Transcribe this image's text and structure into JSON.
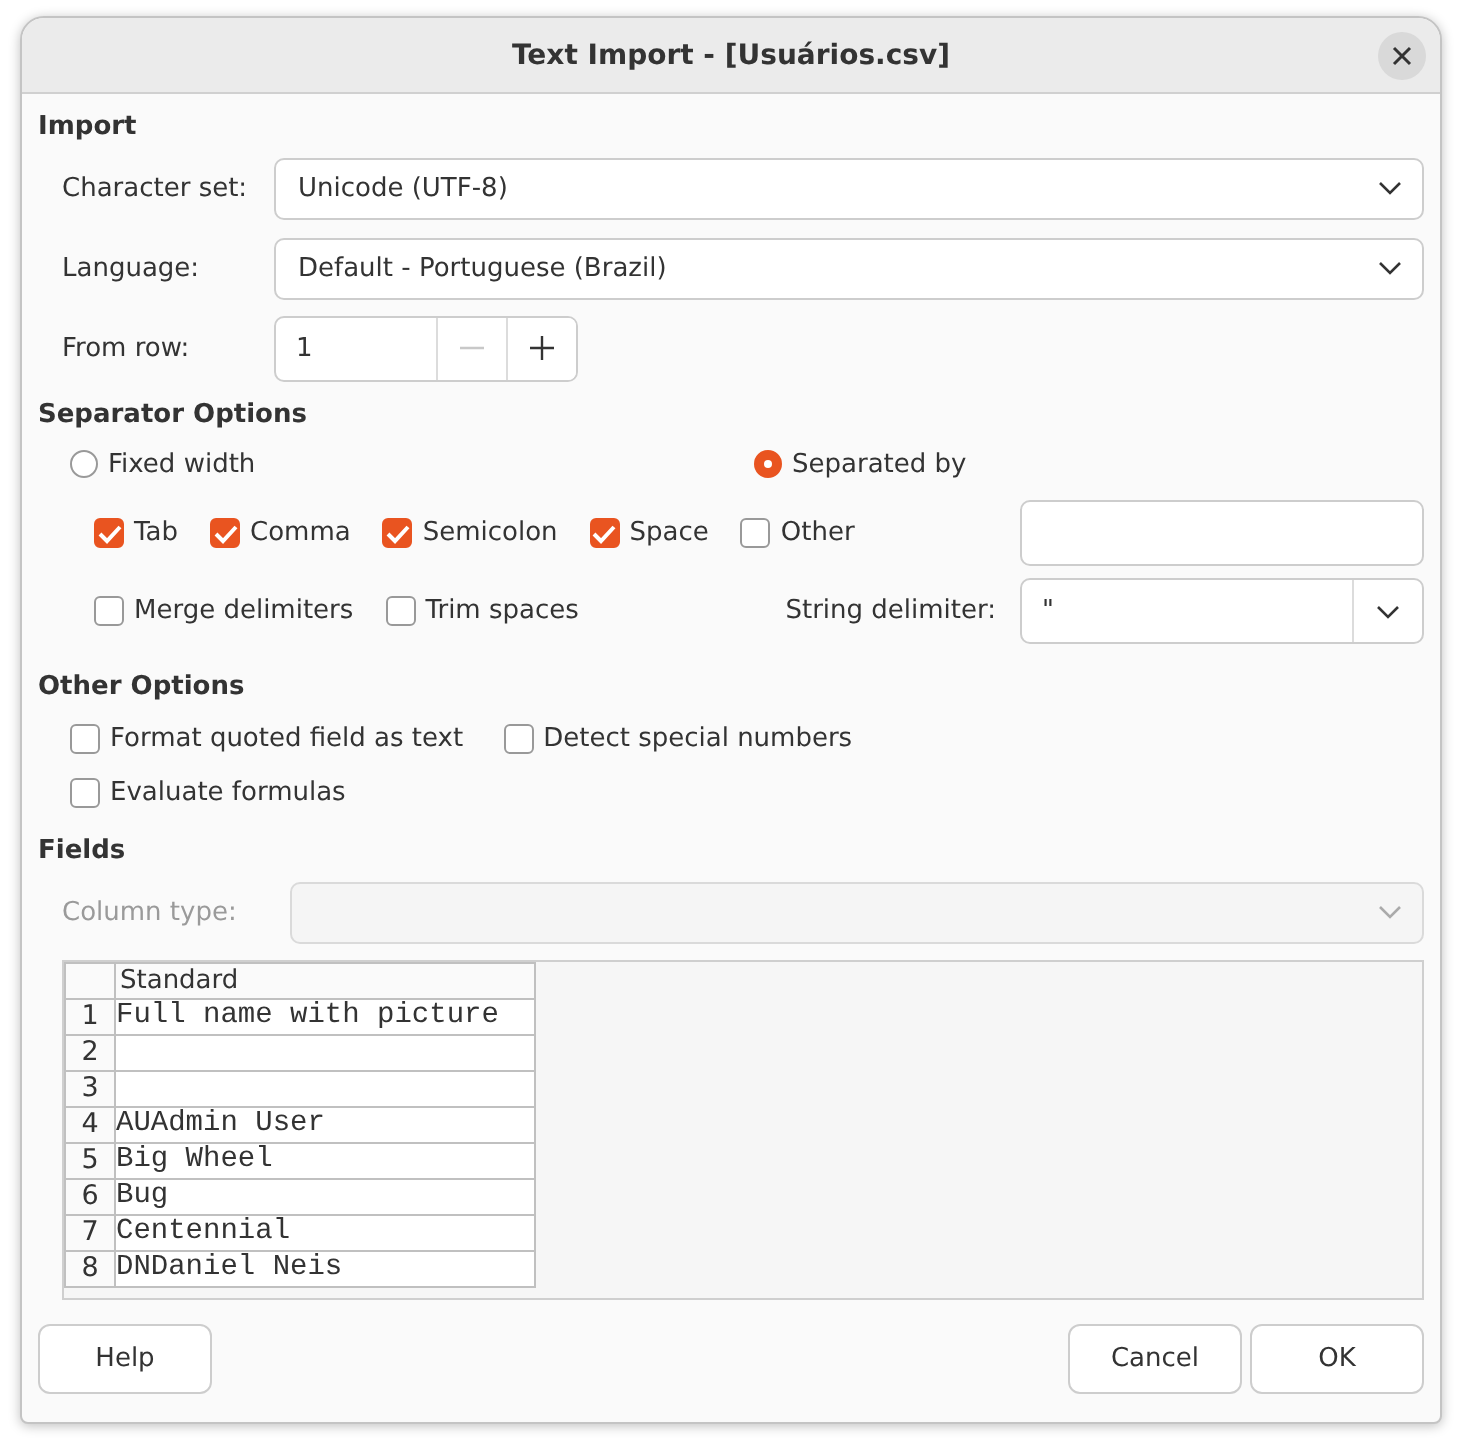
{
  "window": {
    "title": "Text Import - [Usuários.csv]"
  },
  "import": {
    "heading": "Import",
    "fields": [
      {
        "kind": "combo",
        "label": "Character set:",
        "value": "Unicode (UTF-8)"
      },
      {
        "kind": "combo",
        "label": "Language:",
        "value": "Default - Portuguese (Brazil)"
      },
      {
        "kind": "spin",
        "label": "From row:",
        "value": "1",
        "minus_disabled": true
      }
    ]
  },
  "separator_options": {
    "heading": "Separator Options",
    "modes": [
      {
        "label": "Fixed width",
        "selected": false
      },
      {
        "label": "Separated by",
        "selected": true
      }
    ],
    "separators": [
      {
        "label": "Tab",
        "checked": true
      },
      {
        "label": "Comma",
        "checked": true
      },
      {
        "label": "Semicolon",
        "checked": true
      },
      {
        "label": "Space",
        "checked": true
      },
      {
        "label": "Other",
        "checked": false
      }
    ],
    "extras": [
      {
        "label": "Merge delimiters",
        "checked": false
      },
      {
        "label": "Trim spaces",
        "checked": false
      }
    ],
    "string_delimiter": {
      "label": "String delimiter:",
      "value": "\""
    }
  },
  "other_options": {
    "heading": "Other Options",
    "rows": [
      {
        "items": [
          {
            "label": "Format quoted field as text",
            "checked": false
          },
          {
            "label": "Detect special numbers",
            "checked": false
          }
        ]
      },
      {
        "items": [
          {
            "label": "Evaluate formulas",
            "checked": false
          }
        ]
      }
    ]
  },
  "fields": {
    "heading": "Fields",
    "column_type": {
      "label": "Column type:",
      "disabled": true
    },
    "preview": {
      "column_header": "Standard",
      "rows": [
        {
          "number": "1",
          "text": "Full name with picture"
        },
        {
          "number": "2",
          "text": ""
        },
        {
          "number": "3",
          "text": ""
        },
        {
          "number": "4",
          "text": "AUAdmin User"
        },
        {
          "number": "5",
          "text": "Big Wheel"
        },
        {
          "number": "6",
          "text": "Bug"
        },
        {
          "number": "7",
          "text": "Centennial"
        },
        {
          "number": "8",
          "text": "DNDaniel Neis"
        }
      ]
    }
  },
  "buttons": {
    "left": [
      {
        "label": "Help"
      }
    ],
    "right": [
      {
        "label": "Cancel"
      },
      {
        "label": "OK"
      }
    ]
  }
}
